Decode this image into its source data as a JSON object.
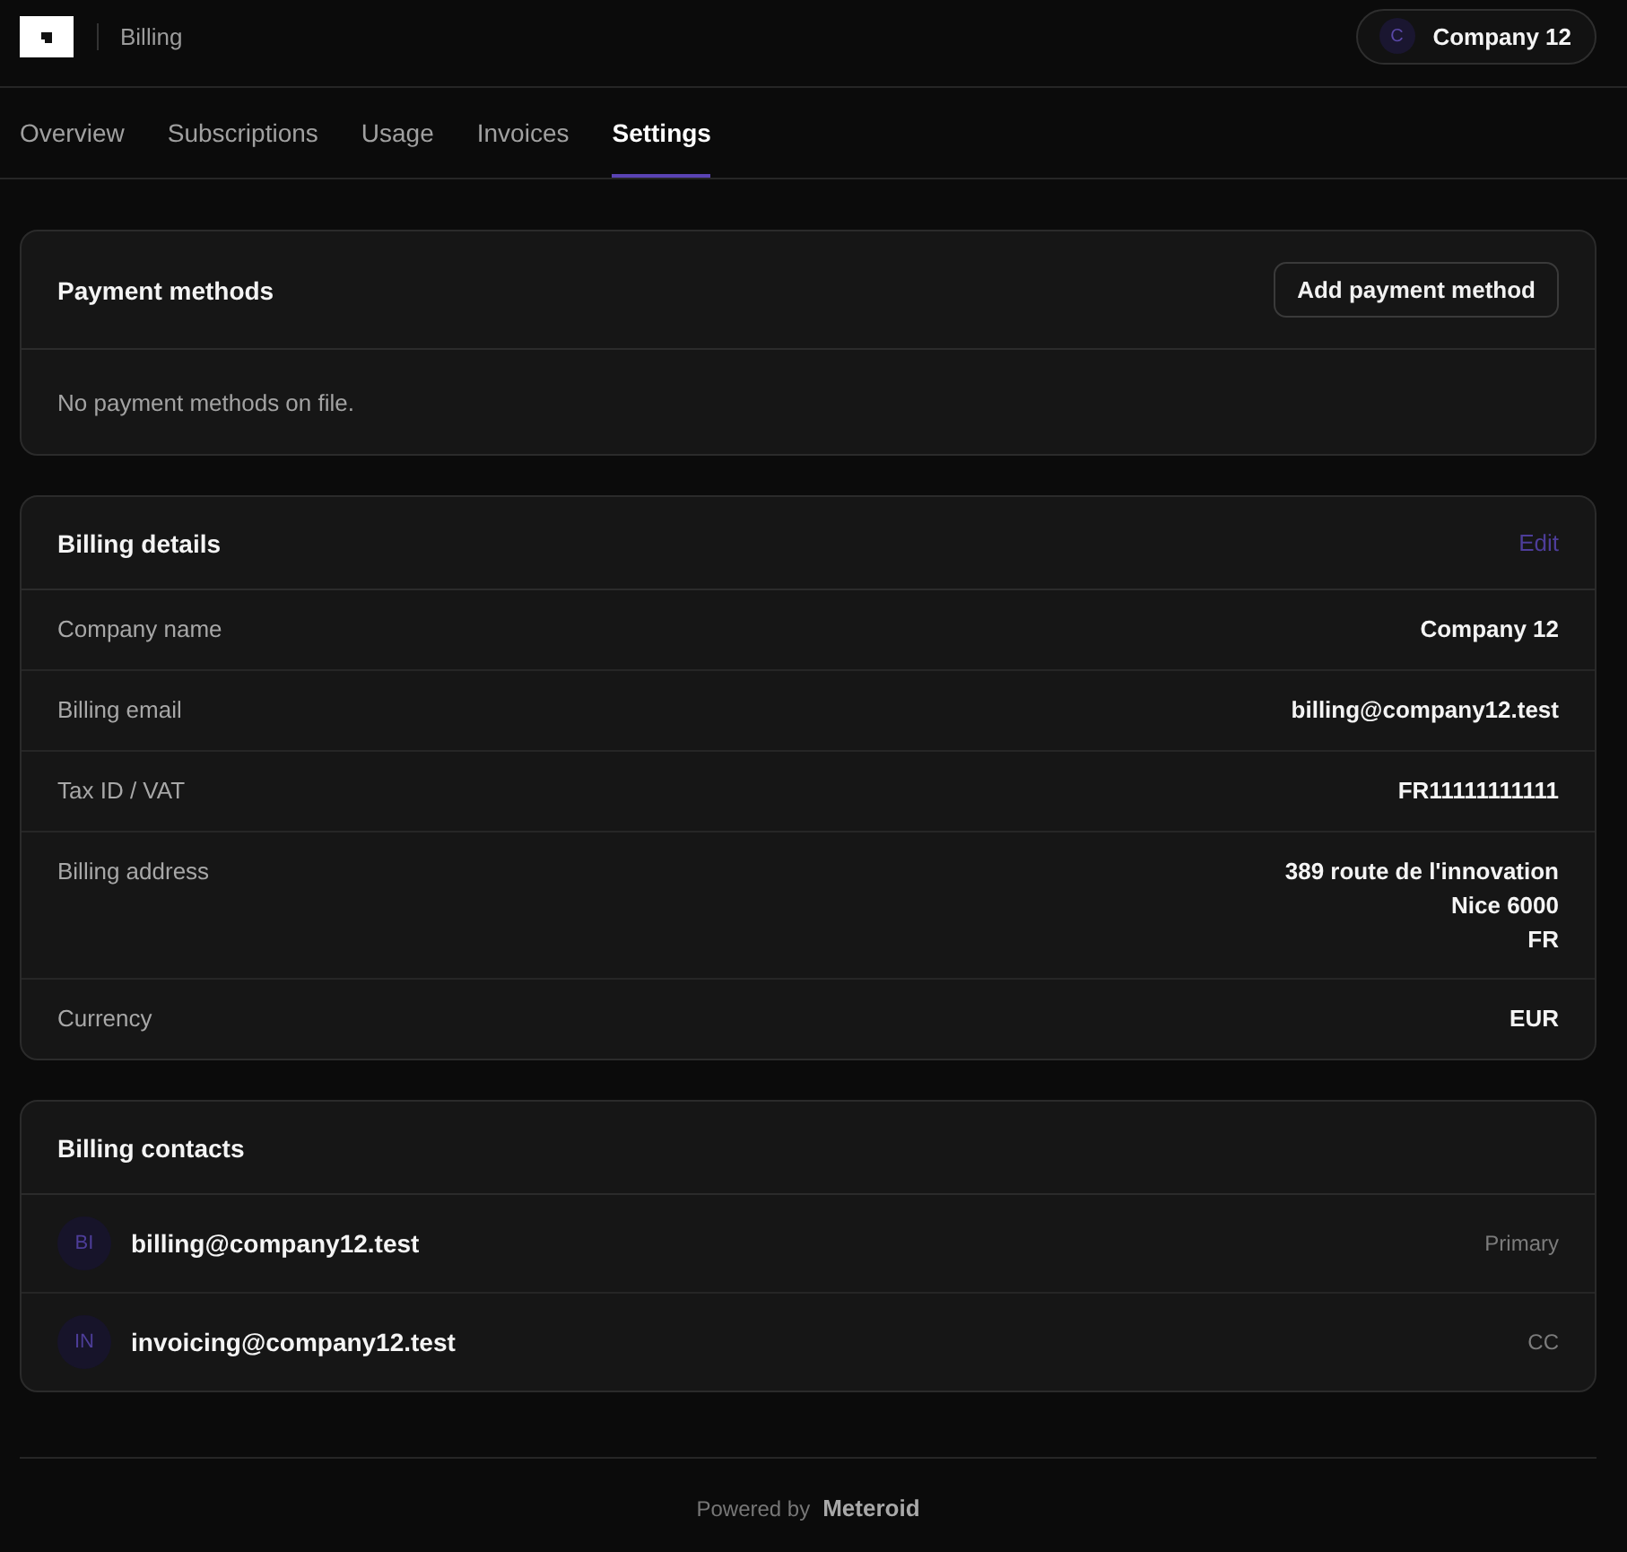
{
  "header": {
    "section_title": "Billing",
    "account": {
      "initial": "C",
      "name": "Company 12"
    }
  },
  "tabs": [
    {
      "label": "Overview",
      "selected": false
    },
    {
      "label": "Subscriptions",
      "selected": false
    },
    {
      "label": "Usage",
      "selected": false
    },
    {
      "label": "Invoices",
      "selected": false
    },
    {
      "label": "Settings",
      "selected": true
    }
  ],
  "payment_methods": {
    "title": "Payment methods",
    "action": "Add payment method",
    "empty_text": "No payment methods on file."
  },
  "billing_details": {
    "title": "Billing details",
    "action": "Edit",
    "rows": [
      {
        "label": "Company name",
        "lines": [
          "Company 12"
        ]
      },
      {
        "label": "Billing email",
        "lines": [
          "billing@company12.test"
        ]
      },
      {
        "label": "Tax ID / VAT",
        "lines": [
          "FR11111111111"
        ]
      },
      {
        "label": "Billing address",
        "lines": [
          "389 route de l'innovation",
          "Nice 6000",
          "FR"
        ]
      },
      {
        "label": "Currency",
        "lines": [
          "EUR"
        ]
      }
    ]
  },
  "billing_contacts": {
    "title": "Billing contacts",
    "contacts": [
      {
        "initials": "BI",
        "email": "billing@company12.test",
        "role": "Primary"
      },
      {
        "initials": "IN",
        "email": "invoicing@company12.test",
        "role": "CC"
      }
    ]
  },
  "footer": {
    "prefix": "Powered by",
    "brand": "Meteroid"
  }
}
